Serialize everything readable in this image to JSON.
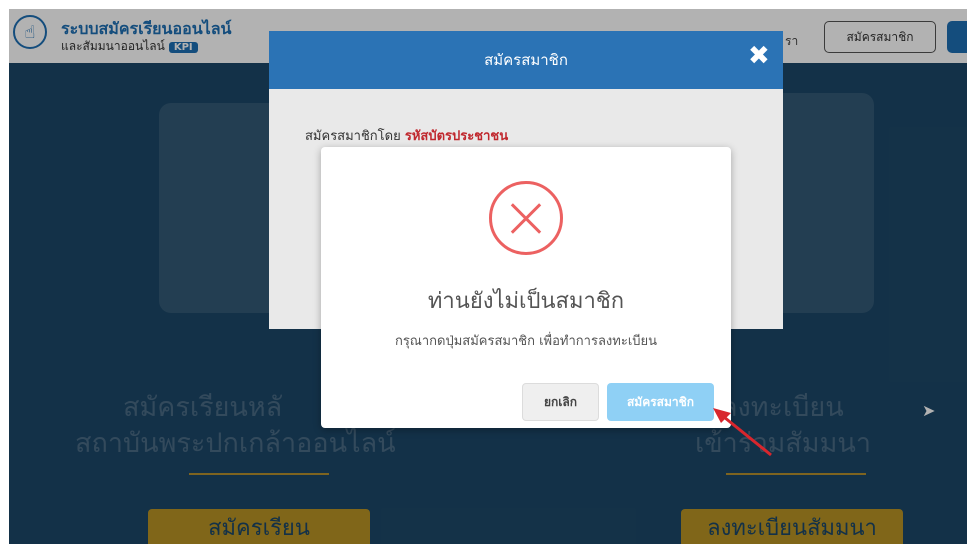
{
  "header": {
    "brand_line1": "ระบบสมัครเรียนออนไลน์",
    "brand_line2": "และสัมมนาออนไลน์",
    "brand_badge": "KPI",
    "nav_fragment": "รา",
    "register_label": "สมัครสมาชิก"
  },
  "hero": {
    "left_title_1": "สมัครเรียนหลั",
    "left_title_2": "สถาบันพระปกเกล้าออนไลน์",
    "right_title_1": "ลงทะเบียน",
    "right_title_2": "เข้าร่วมสัมมนา",
    "left_button": "สมัครเรียน",
    "right_button": "ลงทะเบียนสัมมนา"
  },
  "back_modal": {
    "title": "สมัครสมาชิก",
    "close_symbol": "✖",
    "prefix_text": "สมัครสมาชิกโดย",
    "prefix_highlight": "รหัสบัตรประชาชน"
  },
  "dialog": {
    "title": "ท่านยังไม่เป็นสมาชิก",
    "message": "กรุณากดปุ่มสมัครสมาชิก เพื่อทำการลงทะเบียน",
    "cancel_label": "ยกเลิก",
    "confirm_label": "สมัครสมาชิก",
    "icon": "error-x-icon"
  },
  "colors": {
    "accent": "#2b73b5",
    "error": "#ec6161",
    "confirm": "#8fd0f5",
    "gold": "#b89224",
    "hero_bg": "#1c4767"
  }
}
